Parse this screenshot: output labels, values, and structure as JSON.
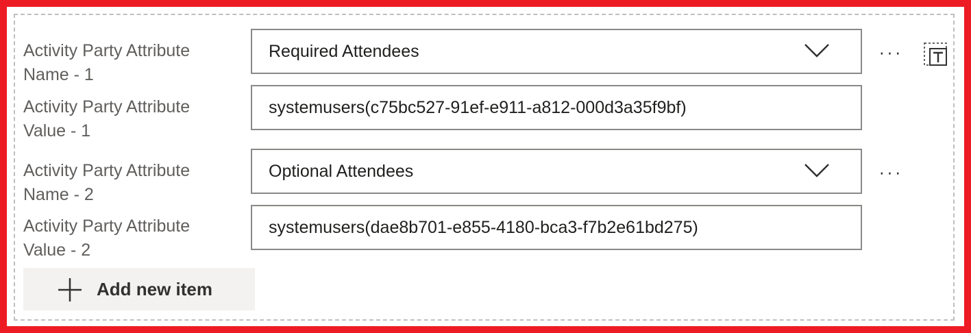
{
  "items": [
    {
      "name_label": "Activity Party Attribute Name - 1",
      "name_value": "Required Attendees",
      "value_label": "Activity Party Attribute Value - 1",
      "value_value": "systemusers(c75bc527-91ef-e911-a812-000d3a35f9bf)"
    },
    {
      "name_label": "Activity Party Attribute Name - 2",
      "name_value": "Optional Attendees",
      "value_label": "Activity Party Attribute Value - 2",
      "value_value": "systemusers(dae8b701-e855-4180-bca3-f7b2e61bd275)"
    }
  ],
  "more_glyph": "···",
  "add_button_label": "Add new item",
  "icons": {
    "chevron": "chevron-down-icon",
    "more": "more-options-icon",
    "insert_token": "insert-token-icon",
    "add": "plus-icon"
  },
  "colors": {
    "highlight": "#ed1c24",
    "field_border": "#8a8886",
    "label_text": "#605e5c",
    "button_bg": "#f3f2f1"
  }
}
